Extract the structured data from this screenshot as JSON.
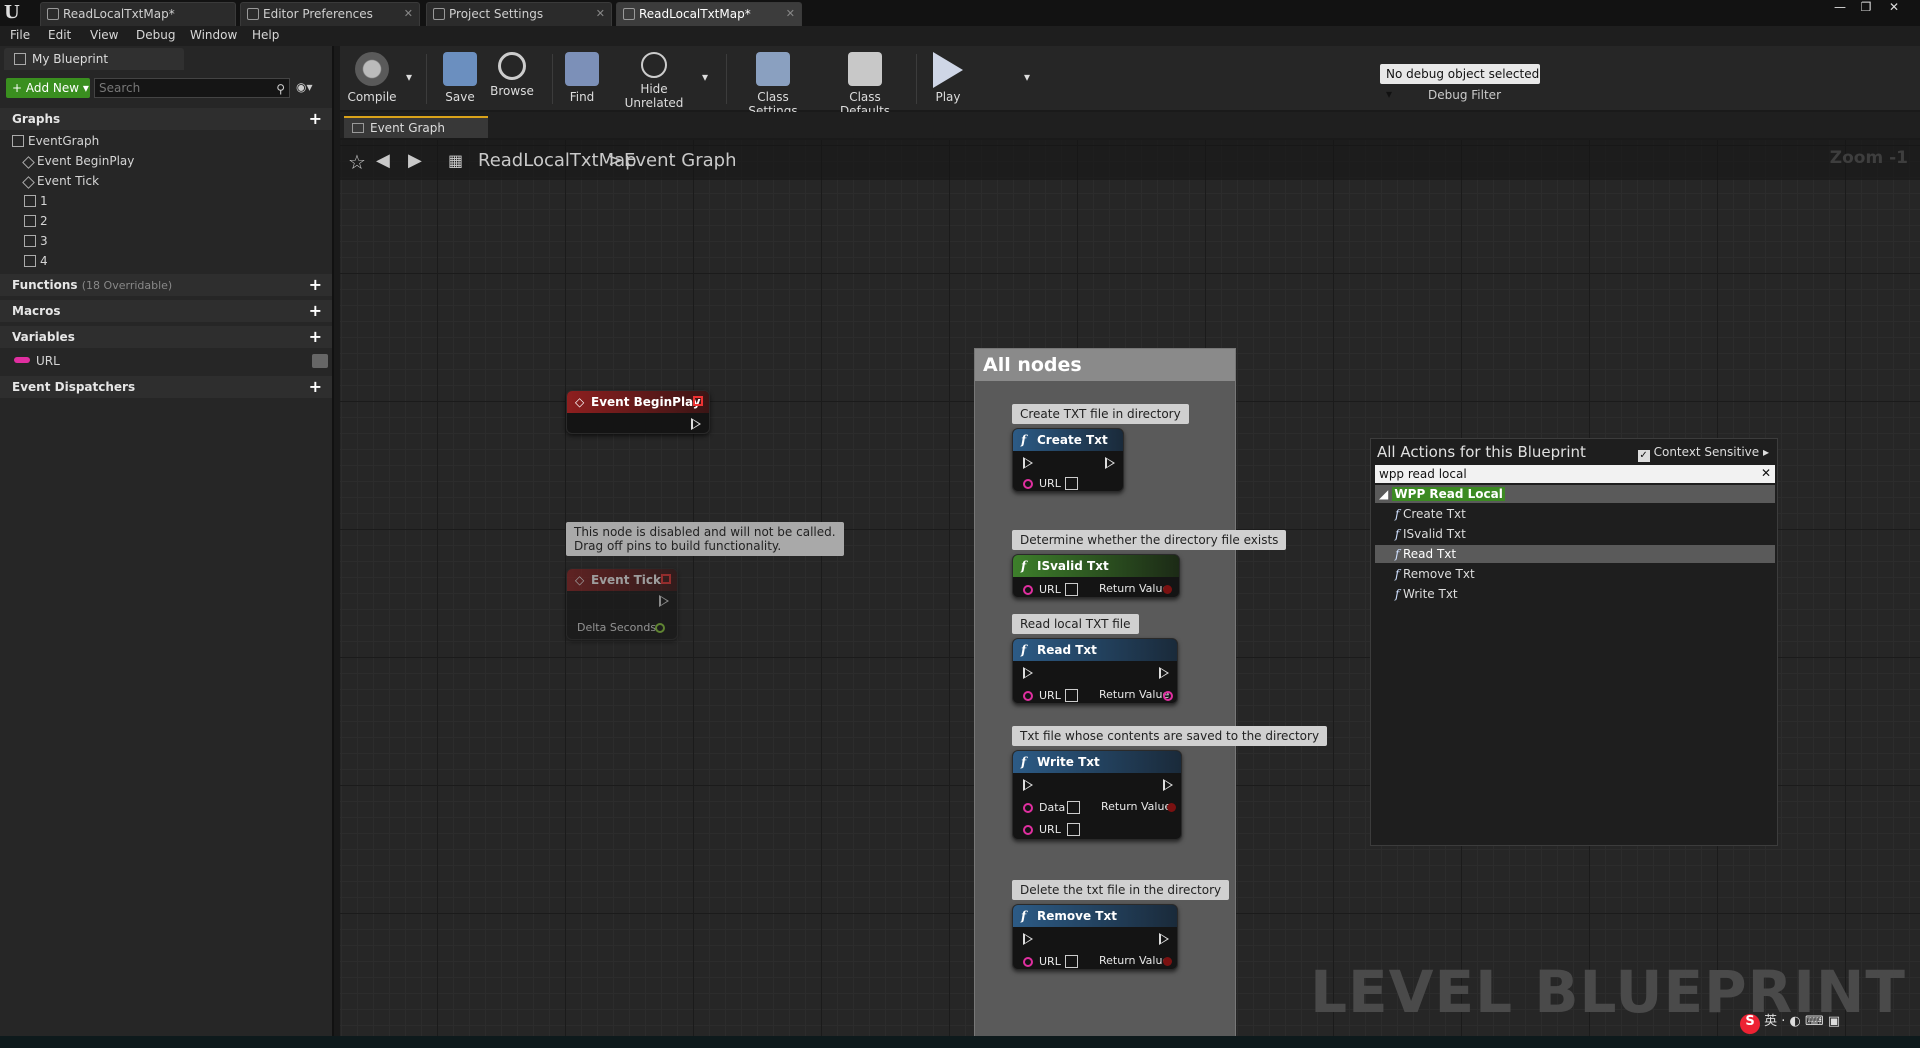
{
  "window": {
    "tabs": [
      {
        "label": "ReadLocalTxtMap*"
      },
      {
        "label": "Editor Preferences"
      },
      {
        "label": "Project Settings"
      },
      {
        "label": "ReadLocalTxtMap*"
      }
    ],
    "controls": {
      "minimize": "—",
      "maximize": "❐",
      "close": "✕"
    }
  },
  "menu": [
    "File",
    "Edit",
    "View",
    "Debug",
    "Window",
    "Help"
  ],
  "left_panel": {
    "tab_label": "My Blueprint",
    "add_new": "Add New",
    "search_placeholder": "Search",
    "graphs": {
      "header": "Graphs",
      "items": [
        {
          "label": "EventGraph"
        },
        {
          "label": "Event BeginPlay"
        },
        {
          "label": "Event Tick"
        },
        {
          "label": "1"
        },
        {
          "label": "2"
        },
        {
          "label": "3"
        },
        {
          "label": "4"
        }
      ]
    },
    "functions": {
      "header": "Functions",
      "sub": "(18 Overridable)"
    },
    "macros": {
      "header": "Macros"
    },
    "variables": {
      "header": "Variables",
      "items": [
        {
          "label": "URL",
          "color": "#e02fa0"
        }
      ]
    },
    "dispatchers": {
      "header": "Event Dispatchers"
    }
  },
  "toolbar": {
    "compile": "Compile",
    "save": "Save",
    "browse": "Browse",
    "find": "Find",
    "hide_unrelated": "Hide Unrelated",
    "class_settings": "Class Settings",
    "class_defaults": "Class Defaults",
    "play": "Play",
    "debug_select": "No debug object selected",
    "debug_filter": "Debug Filter"
  },
  "graph_tab": "Event Graph",
  "breadcrumb": {
    "root": "ReadLocalTxtMap",
    "sep": ">",
    "current": "Event Graph"
  },
  "zoom": "Zoom -1",
  "watermark": "LEVEL BLUEPRINT",
  "comment_box": {
    "title": "All nodes"
  },
  "nodes": {
    "begin_play": {
      "title": "Event BeginPlay"
    },
    "disabled_note": {
      "line1": "This node is disabled and will not be called.",
      "line2": "Drag off pins to build functionality."
    },
    "tick": {
      "title": "Event Tick",
      "pin": "Delta Seconds"
    },
    "create": {
      "comment": "Create TXT file in directory",
      "title": "Create Txt",
      "pin_url": "URL"
    },
    "isvalid": {
      "comment": "Determine whether the directory file exists",
      "title": "ISvalid Txt",
      "pin_url": "URL",
      "ret": "Return Value"
    },
    "read": {
      "comment": "Read local TXT file",
      "title": "Read Txt",
      "pin_url": "URL",
      "ret": "Return Value"
    },
    "write": {
      "comment": "Txt file whose contents are saved to the directory",
      "title": "Write Txt",
      "pin_data": "Data",
      "pin_url": "URL",
      "ret": "Return Value"
    },
    "remove": {
      "comment": "Delete the txt file in the directory",
      "title": "Remove Txt",
      "pin_url": "URL",
      "ret": "Return Value"
    }
  },
  "action_menu": {
    "title": "All Actions for this Blueprint",
    "context_sensitive": "Context Sensitive",
    "search_value": "wpp read local",
    "category": "WPP Read Local",
    "items": [
      {
        "label": "Create Txt"
      },
      {
        "label": "ISvalid Txt"
      },
      {
        "label": "Read Txt"
      },
      {
        "label": "Remove Txt"
      },
      {
        "label": "Write Txt"
      }
    ],
    "selected": "Read Txt"
  },
  "tray": {
    "ime": "英"
  }
}
